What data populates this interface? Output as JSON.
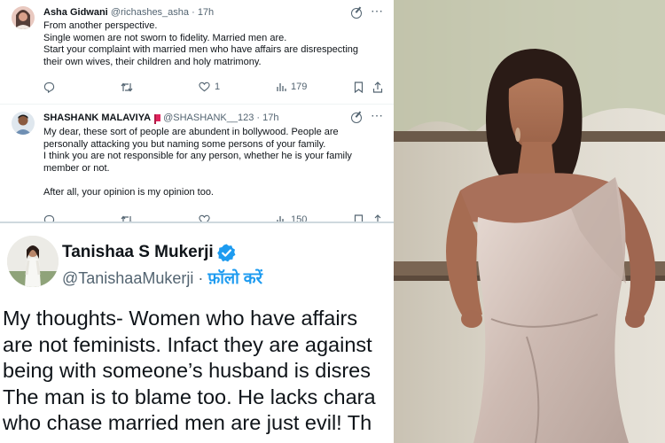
{
  "tweets": [
    {
      "name": "Asha Gidwani",
      "handle": "@richashes_asha",
      "time": "· 17h",
      "lines": [
        "From another perspective.",
        "Single women are not sworn to fidelity. Married men are.",
        "Start your complaint  with married men who have affairs are disrespecting",
        "their own wives, their children  and holy matrimony."
      ],
      "actions": {
        "reply": "",
        "retweet": "",
        "like": "1",
        "views": "179"
      }
    },
    {
      "name": "SHASHANK MALAVIYA",
      "handle": "@SHASHANK__123",
      "time": "· 17h",
      "lines": [
        "My dear, these sort of people are abundent in bollywood. People are",
        "personally attacking you but naming some persons of your family.",
        "I think you are not responsible for any person, whether he is your family",
        "member or not.",
        "",
        "After all, your opinion is my opinion too."
      ],
      "actions": {
        "views": "150"
      }
    }
  ],
  "main_tweet": {
    "name": "Tanishaa S Mukerji",
    "handle": "@TanishaaMukerji",
    "follow_label": "फ़ॉलो करें",
    "lines": [
      "My thoughts-  Women who have affairs",
      "are not feminists. Infact they are against",
      "being with someone’s husband is disres",
      "The man is to blame too. He lacks chara",
      "who chase married men are just evil! Th"
    ]
  },
  "colors": {
    "verified": "#1d9bf0",
    "muted": "#536471",
    "text": "#0f1419",
    "flag": "#e0245e"
  },
  "icons": [
    "more-icon",
    "grok-icon",
    "reply-icon",
    "retweet-icon",
    "like-icon",
    "views-icon",
    "bookmark-icon",
    "share-icon",
    "verified-badge-icon",
    "flag-icon"
  ]
}
